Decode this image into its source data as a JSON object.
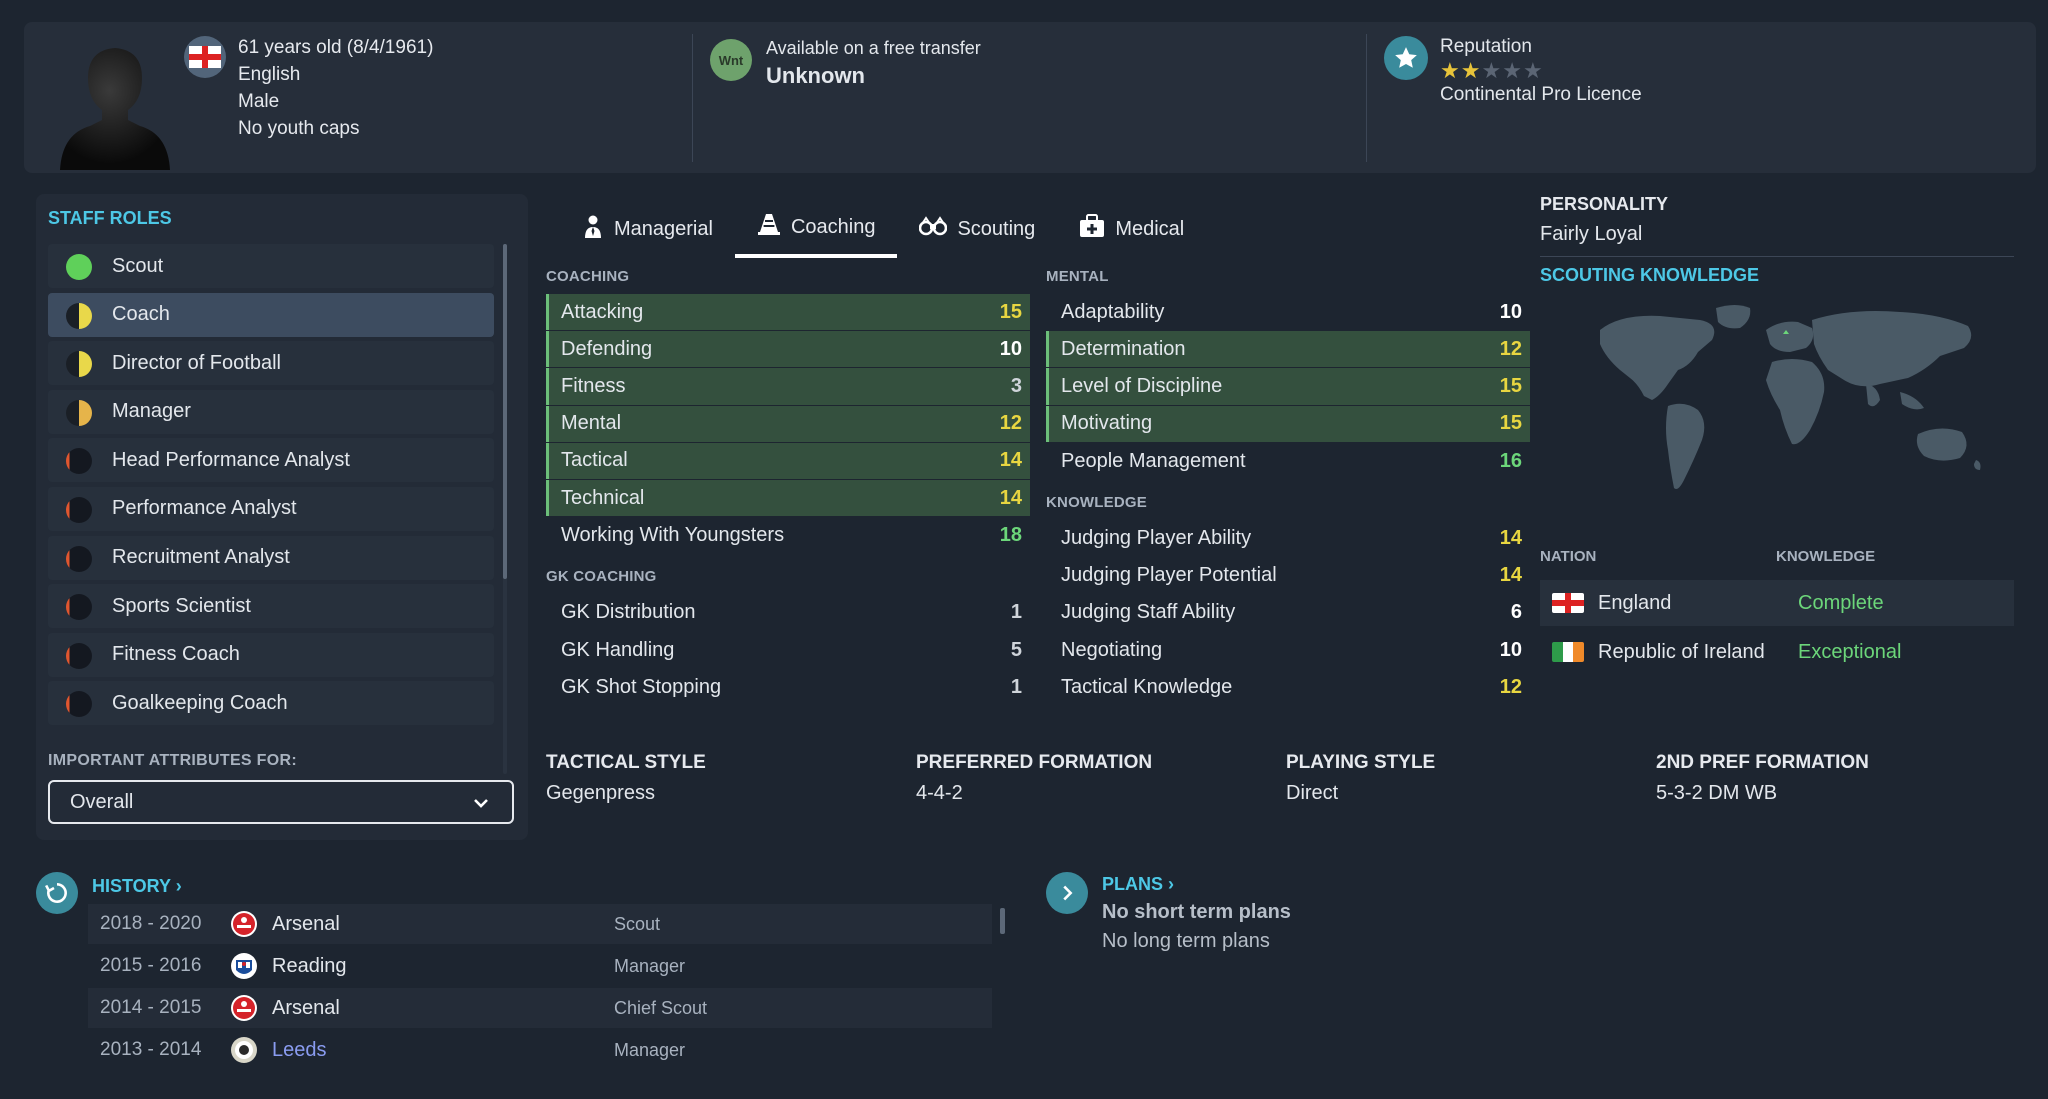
{
  "header": {
    "age_line": "61 years old (8/4/1961)",
    "nationality": "English",
    "gender": "Male",
    "youth_caps": "No youth caps",
    "wnt_badge": "Wnt",
    "transfer_status": "Available on a free transfer",
    "transfer_value": "Unknown",
    "reputation_label": "Reputation",
    "reputation_stars": 2,
    "reputation_max": 5,
    "licence": "Continental Pro Licence"
  },
  "staff_roles": {
    "title": "STAFF ROLES",
    "items": [
      {
        "label": "Scout",
        "dot_color": "#5fd05a",
        "dot_type": "full"
      },
      {
        "label": "Coach",
        "dot_color": "#e9d84a",
        "dot_type": "half",
        "selected": true
      },
      {
        "label": "Director of Football",
        "dot_color": "#e9d84a",
        "dot_type": "half"
      },
      {
        "label": "Manager",
        "dot_color": "#e6b44a",
        "dot_type": "half"
      },
      {
        "label": "Head Performance Analyst",
        "dot_color": "#e0562f",
        "dot_type": "sliver"
      },
      {
        "label": "Performance Analyst",
        "dot_color": "#e0562f",
        "dot_type": "sliver"
      },
      {
        "label": "Recruitment Analyst",
        "dot_color": "#e0562f",
        "dot_type": "sliver"
      },
      {
        "label": "Sports Scientist",
        "dot_color": "#e0562f",
        "dot_type": "sliver"
      },
      {
        "label": "Fitness Coach",
        "dot_color": "#e0562f",
        "dot_type": "sliver"
      },
      {
        "label": "Goalkeeping Coach",
        "dot_color": "#e0562f",
        "dot_type": "sliver"
      }
    ],
    "important_label": "IMPORTANT ATTRIBUTES FOR:",
    "important_value": "Overall"
  },
  "tabs": [
    {
      "label": "Managerial",
      "icon": "manager-icon"
    },
    {
      "label": "Coaching",
      "icon": "cone-icon",
      "active": true
    },
    {
      "label": "Scouting",
      "icon": "binoculars-icon"
    },
    {
      "label": "Medical",
      "icon": "medical-kit-icon"
    }
  ],
  "coaching": {
    "title": "COACHING",
    "rows": [
      {
        "label": "Attacking",
        "value": 15,
        "hl": true
      },
      {
        "label": "Defending",
        "value": 10,
        "hl": true
      },
      {
        "label": "Fitness",
        "value": 3,
        "hl": true
      },
      {
        "label": "Mental",
        "value": 12,
        "hl": true
      },
      {
        "label": "Tactical",
        "value": 14,
        "hl": true
      },
      {
        "label": "Technical",
        "value": 14,
        "hl": true
      },
      {
        "label": "Working With Youngsters",
        "value": 18,
        "hl": false
      }
    ]
  },
  "gk_coaching": {
    "title": "GK COACHING",
    "rows": [
      {
        "label": "GK Distribution",
        "value": 1
      },
      {
        "label": "GK Handling",
        "value": 5
      },
      {
        "label": "GK Shot Stopping",
        "value": 1
      }
    ]
  },
  "mental": {
    "title": "MENTAL",
    "rows": [
      {
        "label": "Adaptability",
        "value": 10,
        "hl": false
      },
      {
        "label": "Determination",
        "value": 12,
        "hl": true
      },
      {
        "label": "Level of Discipline",
        "value": 15,
        "hl": true
      },
      {
        "label": "Motivating",
        "value": 15,
        "hl": true
      },
      {
        "label": "People Management",
        "value": 16,
        "hl": false
      }
    ]
  },
  "knowledge": {
    "title": "KNOWLEDGE",
    "rows": [
      {
        "label": "Judging Player Ability",
        "value": 14
      },
      {
        "label": "Judging Player Potential",
        "value": 14
      },
      {
        "label": "Judging Staff Ability",
        "value": 6
      },
      {
        "label": "Negotiating",
        "value": 10
      },
      {
        "label": "Tactical Knowledge",
        "value": 12
      }
    ]
  },
  "personality": {
    "title": "PERSONALITY",
    "value": "Fairly Loyal"
  },
  "scouting_knowledge": {
    "title": "SCOUTING KNOWLEDGE",
    "nation_header": "NATION",
    "knowledge_header": "KNOWLEDGE",
    "rows": [
      {
        "nation": "England",
        "knowledge": "Complete",
        "flag": "england"
      },
      {
        "nation": "Republic of Ireland",
        "knowledge": "Exceptional",
        "flag": "ireland"
      }
    ]
  },
  "styles": {
    "tactical_style_label": "TACTICAL STYLE",
    "tactical_style": "Gegenpress",
    "preferred_formation_label": "PREFERRED FORMATION",
    "preferred_formation": "4-4-2",
    "playing_style_label": "PLAYING STYLE",
    "playing_style": "Direct",
    "second_formation_label": "2ND PREF FORMATION",
    "second_formation": "5-3-2 DM WB"
  },
  "history": {
    "title": "HISTORY",
    "rows": [
      {
        "years": "2018 - 2020",
        "club": "Arsenal",
        "role": "Scout",
        "crest": "arsenal"
      },
      {
        "years": "2015 - 2016",
        "club": "Reading",
        "role": "Manager",
        "crest": "reading"
      },
      {
        "years": "2014 - 2015",
        "club": "Arsenal",
        "role": "Chief Scout",
        "crest": "arsenal"
      },
      {
        "years": "2013 - 2014",
        "club": "Leeds",
        "role": "Manager",
        "crest": "leeds"
      }
    ]
  },
  "plans": {
    "title": "PLANS",
    "short": "No short term plans",
    "long": "No long term plans"
  },
  "colors": {
    "accent_cyan": "#4dc8e6",
    "highlight_green": "#34503e",
    "value_yellow": "#e8d641",
    "value_green": "#6cd67a"
  }
}
